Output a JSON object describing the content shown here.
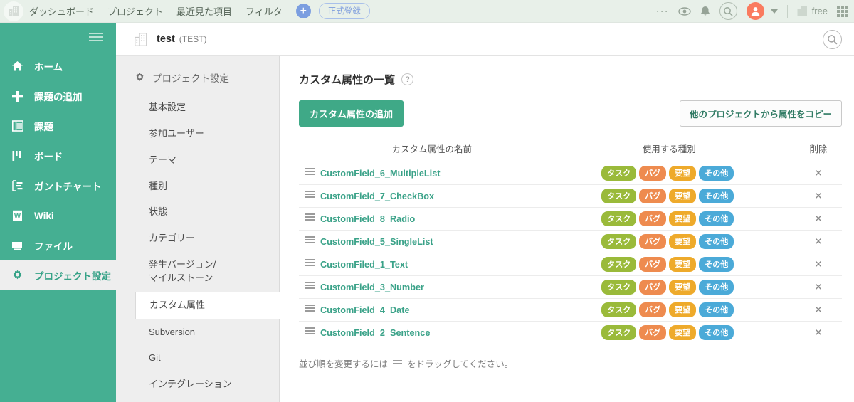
{
  "globalbar": {
    "logo_icon": "building-icon",
    "nav": [
      {
        "label": "ダッシュボード",
        "name": "global-nav-dashboard"
      },
      {
        "label": "プロジェクト",
        "name": "global-nav-project"
      },
      {
        "label": "最近見た項目",
        "name": "global-nav-recent"
      },
      {
        "label": "フィルタ",
        "name": "global-nav-filter"
      }
    ],
    "plus_label": "+",
    "register_badge": "正式登録",
    "dots": "···",
    "plan_label": "free",
    "icons": {
      "more": "more-horizontal-icon",
      "watch": "eye-icon",
      "notification": "bell-icon",
      "search": "search-icon",
      "avatar": "user-avatar-icon",
      "caret": "chevron-down-icon",
      "plan": "building-icon",
      "apps": "grid-apps-icon"
    },
    "colors": {
      "background": "#e8f0e9",
      "accent_blue": "#7b9ee0",
      "avatar": "#fa7b5f"
    }
  },
  "leftnav": {
    "background": "#45af92",
    "hamburger": "hamburger-icon",
    "items": [
      {
        "label": "ホーム",
        "icon": "home-icon",
        "active": false
      },
      {
        "label": "課題の追加",
        "icon": "plus-icon",
        "active": false
      },
      {
        "label": "課題",
        "icon": "list-icon",
        "active": false
      },
      {
        "label": "ボード",
        "icon": "board-icon",
        "active": false
      },
      {
        "label": "ガントチャート",
        "icon": "gantt-chart-icon",
        "active": false
      },
      {
        "label": "Wiki",
        "icon": "wiki-document-icon",
        "active": false
      },
      {
        "label": "ファイル",
        "icon": "file-folder-icon",
        "active": false
      },
      {
        "label": "プロジェクト設定",
        "icon": "gear-icon",
        "active": true
      }
    ]
  },
  "project_header": {
    "icon": "building-icon",
    "name": "test",
    "key": "(TEST)",
    "search_icon": "search-icon"
  },
  "subnav": {
    "heading": "プロジェクト設定",
    "heading_icon": "gear-icon",
    "items": [
      {
        "label": "基本設定",
        "active": false
      },
      {
        "label": "参加ユーザー",
        "active": false
      },
      {
        "label": "テーマ",
        "active": false
      },
      {
        "label": "種別",
        "active": false
      },
      {
        "label": "状態",
        "active": false
      },
      {
        "label": "カテゴリー",
        "active": false
      },
      {
        "label": "発生バージョン/\nマイルストーン",
        "active": false
      },
      {
        "label": "カスタム属性",
        "active": true
      },
      {
        "label": "Subversion",
        "active": false
      },
      {
        "label": "Git",
        "active": false
      },
      {
        "label": "インテグレーション",
        "active": false
      }
    ]
  },
  "main": {
    "title": "カスタム属性の一覧",
    "help_icon": "question-mark-icon",
    "add_button": "カスタム属性の追加",
    "copy_button": "他のプロジェクトから属性をコピー",
    "columns": {
      "handle": "",
      "name": "カスタム属性の名前",
      "types": "使用する種別",
      "delete": "削除"
    },
    "tag_colors": {
      "タスク": "#9aba3a",
      "バグ": "#ee8b4f",
      "要望": "#eeaa2b",
      "その他": "#4baad8"
    },
    "rows": [
      {
        "name": "CustomField_6_MultipleList",
        "types": [
          "タスク",
          "バグ",
          "要望",
          "その他"
        ],
        "delete": "✕"
      },
      {
        "name": "CustomField_7_CheckBox",
        "types": [
          "タスク",
          "バグ",
          "要望",
          "その他"
        ],
        "delete": "✕"
      },
      {
        "name": "CustomField_8_Radio",
        "types": [
          "タスク",
          "バグ",
          "要望",
          "その他"
        ],
        "delete": "✕"
      },
      {
        "name": "CustomField_5_SingleList",
        "types": [
          "タスク",
          "バグ",
          "要望",
          "その他"
        ],
        "delete": "✕"
      },
      {
        "name": "CustomFiled_1_Text",
        "types": [
          "タスク",
          "バグ",
          "要望",
          "その他"
        ],
        "delete": "✕"
      },
      {
        "name": "CustomField_3_Number",
        "types": [
          "タスク",
          "バグ",
          "要望",
          "その他"
        ],
        "delete": "✕"
      },
      {
        "name": "CustomField_4_Date",
        "types": [
          "タスク",
          "バグ",
          "要望",
          "その他"
        ],
        "delete": "✕"
      },
      {
        "name": "CustomField_2_Sentence",
        "types": [
          "タスク",
          "バグ",
          "要望",
          "その他"
        ],
        "delete": "✕"
      }
    ],
    "note_before": "並び順を変更するには",
    "note_after": "をドラッグしてください。",
    "note_icon": "drag-handle-icon"
  }
}
